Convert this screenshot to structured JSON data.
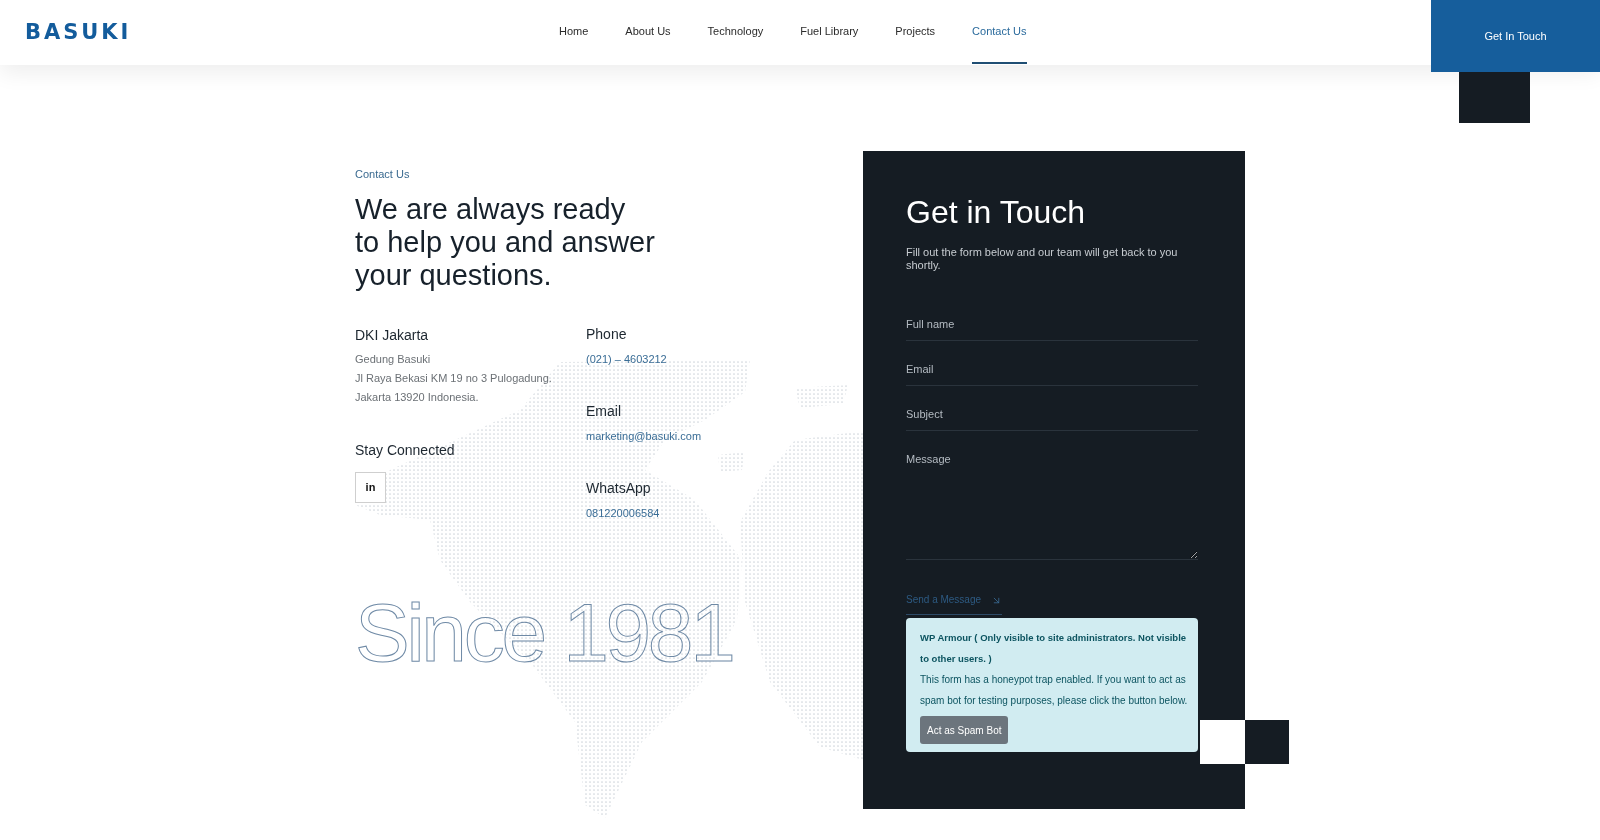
{
  "header": {
    "logo": "BASUKI",
    "nav": [
      {
        "label": "Home",
        "selected": false
      },
      {
        "label": "About Us",
        "selected": false
      },
      {
        "label": "Technology",
        "selected": false
      },
      {
        "label": "Fuel Library",
        "selected": false
      },
      {
        "label": "Projects",
        "selected": false
      },
      {
        "label": "Contact Us",
        "selected": true
      }
    ],
    "cta": "Get In Touch"
  },
  "intro": {
    "eyebrow": "Contact Us",
    "heading": [
      "We are always ready",
      "to help you and answer",
      "your questions."
    ]
  },
  "office": {
    "title": "DKI Jakarta",
    "address": [
      "Gedung Basuki",
      "Jl Raya Bekasi KM 19 no 3 Pulogadung.",
      "Jakarta 13920 Indonesia."
    ]
  },
  "social": {
    "title": "Stay Connected",
    "links": [
      {
        "label": "in"
      }
    ]
  },
  "contacts": [
    {
      "label": "Phone",
      "value": "(021) – 4603212"
    },
    {
      "label": "Email",
      "value": "marketing@basuki.com"
    },
    {
      "label": "WhatsApp",
      "value": "081220006584"
    }
  ],
  "tagline": "Since 1981",
  "form": {
    "title": "Get in Touch",
    "subtitle": "Fill out the form below and our team will get back to you shortly.",
    "fields": [
      {
        "kind": "input",
        "placeholder": "Full name"
      },
      {
        "kind": "input",
        "placeholder": "Email"
      },
      {
        "kind": "input",
        "placeholder": "Subject"
      },
      {
        "kind": "textarea",
        "placeholder": "Message"
      }
    ],
    "submit": "Send a Message",
    "notice": {
      "title": "WP Armour ( Only visible to site administrators. Not visible to other users. )",
      "body": "This form has a honeypot trap enabled. If you want to act as spam bot for testing purposes, please click the button below.",
      "button": "Act as Spam Bot"
    }
  }
}
